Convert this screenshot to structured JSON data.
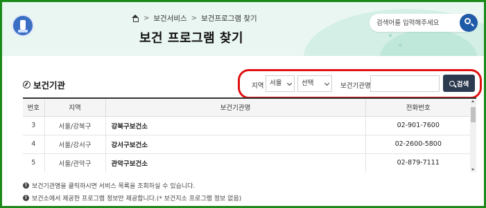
{
  "header": {
    "breadcrumb": [
      "보건서비스",
      "보건프로그램 찾기"
    ],
    "title": "보건 프로그램 찾기",
    "search_placeholder": "검색어를 입력해주세요"
  },
  "section": {
    "title": "보건기관"
  },
  "filter": {
    "region_label": "지역",
    "region_value": "서울",
    "district_value": "선택",
    "institution_label": "보건기관명",
    "institution_value": "",
    "search_label": "검색"
  },
  "table": {
    "headers": [
      "번호",
      "지역",
      "보건기관명",
      "전화번호"
    ],
    "rows": [
      {
        "num": "3",
        "region": "서울/강북구",
        "name": "강북구보건소",
        "tel": "02-901-7600"
      },
      {
        "num": "4",
        "region": "서울/강서구",
        "name": "강서구보건소",
        "tel": "02-2600-5800"
      },
      {
        "num": "5",
        "region": "서울/관악구",
        "name": "관악구보건소",
        "tel": "02-879-7111"
      }
    ]
  },
  "notes": [
    "보건기관명을 클릭하시면 서비스 목록을 조회하실 수 있습니다.",
    "보건소에서 제공한 프로그램 정보만 제공합니다.(* 보건지소 프로그램 정보 없음)"
  ],
  "colors": {
    "frame": "#1a8a1a",
    "highlight": "#e01010",
    "search_button": "#2b3a4e",
    "top_search_button": "#1f5aa8"
  }
}
